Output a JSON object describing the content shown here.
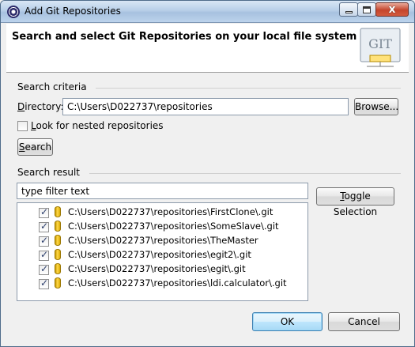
{
  "window": {
    "title": "Add Git Repositories",
    "close_glyph": "x"
  },
  "banner": {
    "title": "Search and select Git Repositories on your local file system",
    "logo_text": "GIT"
  },
  "criteria": {
    "section_label": "Search criteria",
    "directory_label_u": "D",
    "directory_label_rest": "irectory:",
    "directory_value": "C:\\Users\\D022737\\repositories",
    "browse_label": "Browse...",
    "nested_label_u": "L",
    "nested_label_rest": "ook for nested repositories",
    "nested_checked": false,
    "search_label_u": "S",
    "search_label_rest": "earch"
  },
  "result": {
    "section_label": "Search result",
    "filter_placeholder": "type filter text",
    "toggle_label_u": "T",
    "toggle_label_rest": "oggle Selection",
    "items": [
      {
        "path": "C:\\Users\\D022737\\repositories\\FirstClone\\.git",
        "checked": true
      },
      {
        "path": "C:\\Users\\D022737\\repositories\\SomeSlave\\.git",
        "checked": true
      },
      {
        "path": "C:\\Users\\D022737\\repositories\\TheMaster",
        "checked": true
      },
      {
        "path": "C:\\Users\\D022737\\repositories\\egit2\\.git",
        "checked": true
      },
      {
        "path": "C:\\Users\\D022737\\repositories\\egit\\.git",
        "checked": true
      },
      {
        "path": "C:\\Users\\D022737\\repositories\\ldi.calculator\\.git",
        "checked": true
      }
    ]
  },
  "footer": {
    "ok_label": "OK",
    "cancel_label": "Cancel"
  },
  "colors": {
    "titlebar": "#b8cfe8",
    "default_button_border": "#3c7fb1",
    "repo_icon": "#ffd84a"
  },
  "icons": {
    "app": "eclipse-icon",
    "logo": "git-logo-icon",
    "repo": "repository-icon"
  }
}
